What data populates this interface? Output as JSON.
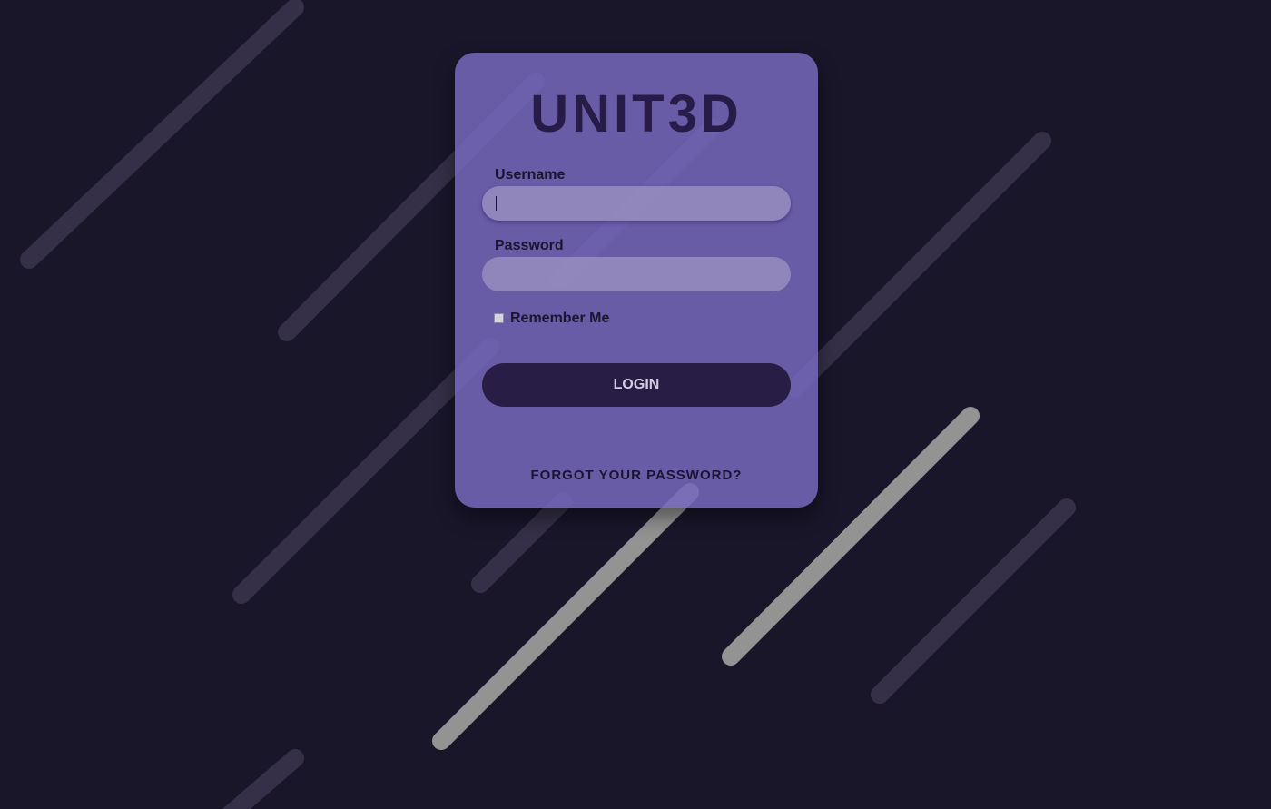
{
  "brand": {
    "logo_text": "UNIT3D"
  },
  "login_form": {
    "username_label": "Username",
    "username_value": "",
    "password_label": "Password",
    "password_value": "",
    "remember_label": "Remember Me",
    "remember_checked": false,
    "login_button": "LOGIN",
    "forgot_link": "FORGOT YOUR PASSWORD?"
  },
  "colors": {
    "background": "#19162a",
    "card": "#7668bc",
    "logo_text": "#261c47",
    "button": "#281d45",
    "button_text": "#d2cde3",
    "streak_dim": "#3a3547",
    "streak_bright": "#9a9a9a"
  }
}
